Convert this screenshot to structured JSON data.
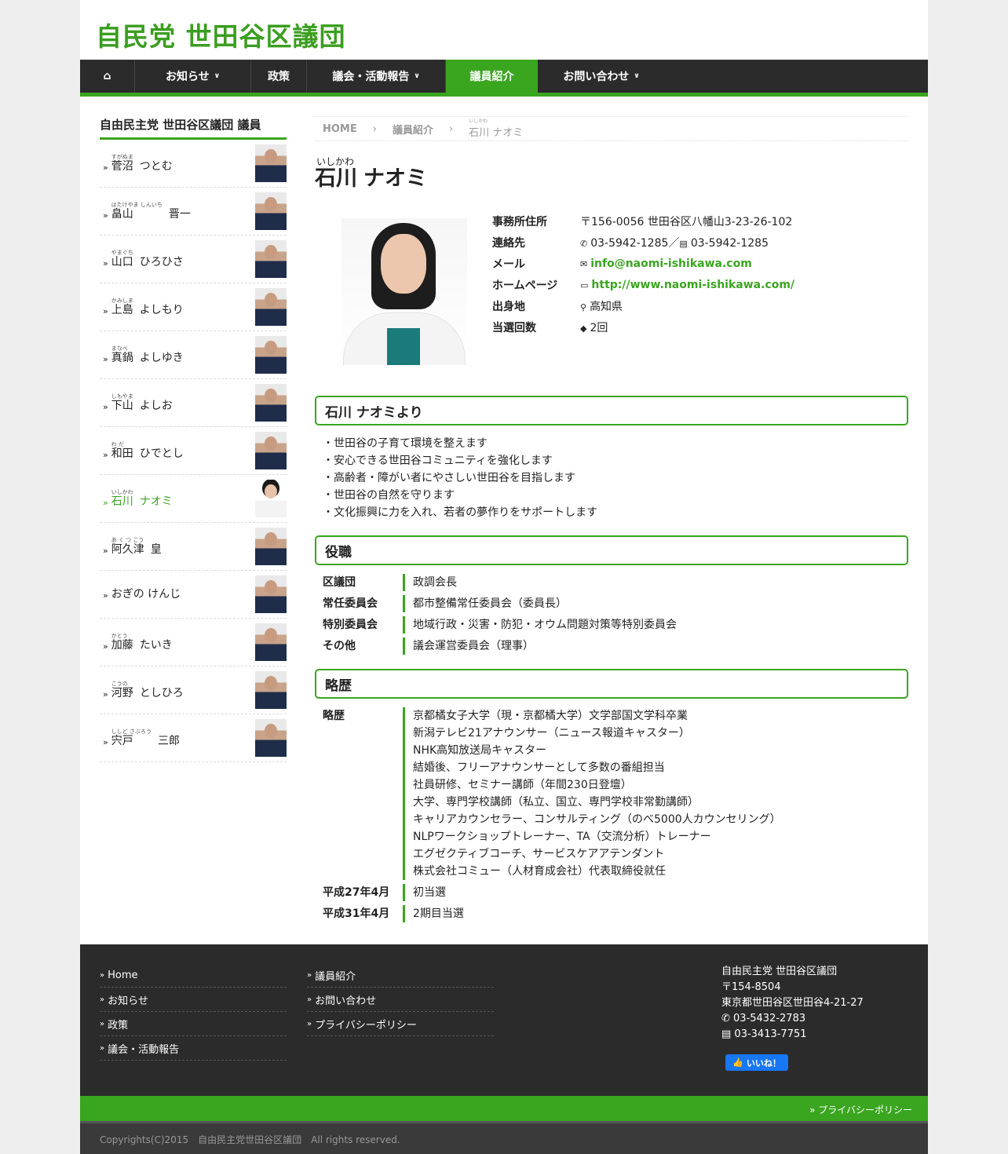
{
  "site": {
    "logo": "自民党 世田谷区議団"
  },
  "nav": {
    "home_icon": "home-icon",
    "items": [
      {
        "label": "お知らせ"
      },
      {
        "label": "政策"
      },
      {
        "label": "議会・活動報告"
      },
      {
        "label": "議員紹介"
      },
      {
        "label": "お問い合わせ"
      }
    ]
  },
  "sidebar": {
    "title": "自由民主党 世田谷区議団 議員",
    "members": [
      {
        "ruby": "すがぬま",
        "kanji": "菅沼",
        "rest": "つとむ"
      },
      {
        "ruby": "はたけやま しんいち",
        "kanji": "畠山",
        "rest": "晋一"
      },
      {
        "ruby": "やまぐち",
        "kanji": "山口",
        "rest": "ひろひさ"
      },
      {
        "ruby": "かみしま",
        "kanji": "上島",
        "rest": "よしもり"
      },
      {
        "ruby": "まなべ",
        "kanji": "真鍋",
        "rest": "よしゆき"
      },
      {
        "ruby": "しもやま",
        "kanji": "下山",
        "rest": "よしお"
      },
      {
        "ruby": "わ だ",
        "kanji": "和田",
        "rest": "ひでとし"
      },
      {
        "ruby": "いしかわ",
        "kanji": "石川",
        "rest": "ナオミ"
      },
      {
        "ruby": "あ く つ こう",
        "kanji": "阿久津",
        "rest": "皇"
      },
      {
        "ruby": "",
        "kanji": "",
        "rest": "おぎの けんじ"
      },
      {
        "ruby": "かとう",
        "kanji": "加藤",
        "rest": "たいき"
      },
      {
        "ruby": "こうの",
        "kanji": "河野",
        "rest": "としひろ"
      },
      {
        "ruby": "ししど さぶろう",
        "kanji": "宍戸",
        "rest": "三郎"
      }
    ]
  },
  "breadcrumb": {
    "home": "HOME",
    "section": "議員紹介",
    "current_ruby": "いしかわ",
    "current": "石川 ナオミ"
  },
  "profile": {
    "ruby": "いしかわ",
    "kanji": "石川",
    "rest": "ナオミ",
    "info": [
      {
        "label": "事務所住所",
        "value": "〒156-0056 世田谷区八幡山3-23-26-102",
        "icon": ""
      },
      {
        "label": "連絡先",
        "value": "03-5942-1285／",
        "icon": "phone-icon",
        "value2": "03-5942-1285",
        "icon2": "fax-icon"
      },
      {
        "label": "メール",
        "value": "info@naomi-ishikawa.com",
        "icon": "mail-icon"
      },
      {
        "label": "ホームページ",
        "value": "http://www.naomi-ishikawa.com/",
        "icon": "monitor-icon"
      },
      {
        "label": "出身地",
        "value": "高知県",
        "icon": "map-marker-icon"
      },
      {
        "label": "当選回数",
        "value": "2回",
        "icon": "tag-icon"
      }
    ]
  },
  "message": {
    "heading": "石川 ナオミより",
    "items": [
      "・世田谷の子育て環境を整えます",
      "・安心できる世田谷コミュニティを強化します",
      "・高齢者・障がい者にやさしい世田谷を目指します",
      "・世田谷の自然を守ります",
      "・文化振興に力を入れ、若者の夢作りをサポートします"
    ]
  },
  "positions": {
    "heading": "役職",
    "rows": [
      {
        "label": "区議団",
        "value": "政調会長"
      },
      {
        "label": "常任委員会",
        "value": "都市整備常任委員会（委員長）"
      },
      {
        "label": "特別委員会",
        "value": "地域行政・災害・防犯・オウム問題対策等特別委員会"
      },
      {
        "label": "その他",
        "value": "議会運営委員会（理事）"
      }
    ]
  },
  "history": {
    "heading": "略歴",
    "label": "略歴",
    "lines": [
      "京都橘女子大学（現・京都橘大学）文学部国文学科卒業",
      "新潟テレビ21アナウンサー（ニュース報道キャスター）",
      "NHK高知放送局キャスター",
      "結婚後、フリーアナウンサーとして多数の番組担当",
      "社員研修、セミナー講師（年間230日登壇）",
      "大学、専門学校講師（私立、国立、専門学校非常勤講師）",
      "キャリアカウンセラー、コンサルティング（のべ5000人カウンセリング）",
      "NLPワークショップトレーナー、TA（交流分析）トレーナー",
      "エグゼクティブコーチ、サービスケアアテンダント",
      "株式会社コミュー（人材育成会社）代表取締役就任"
    ],
    "events": [
      {
        "label": "平成27年4月",
        "value": "初当選"
      },
      {
        "label": "平成31年4月",
        "value": "2期目当選"
      }
    ]
  },
  "footer": {
    "col1": [
      "Home",
      "お知らせ",
      "政策",
      "議会・活動報告"
    ],
    "col2": [
      "議員紹介",
      "お問い合わせ",
      "プライバシーポリシー"
    ],
    "address": {
      "org": "自由民主党 世田谷区議団",
      "zip": "〒154-8504",
      "addr": "東京都世田谷区世田谷4-21-27",
      "tel": "03-5432-2783",
      "fax": "03-3413-7751"
    },
    "like_button": "いいね！",
    "privacy": "プライバシーポリシー",
    "copyright": "Copyrights(C)2015　自由民主党世田谷区議団　All rights reserved."
  },
  "colors": {
    "accent": "#3aa51f",
    "nav_bg": "#2b2b2b"
  }
}
